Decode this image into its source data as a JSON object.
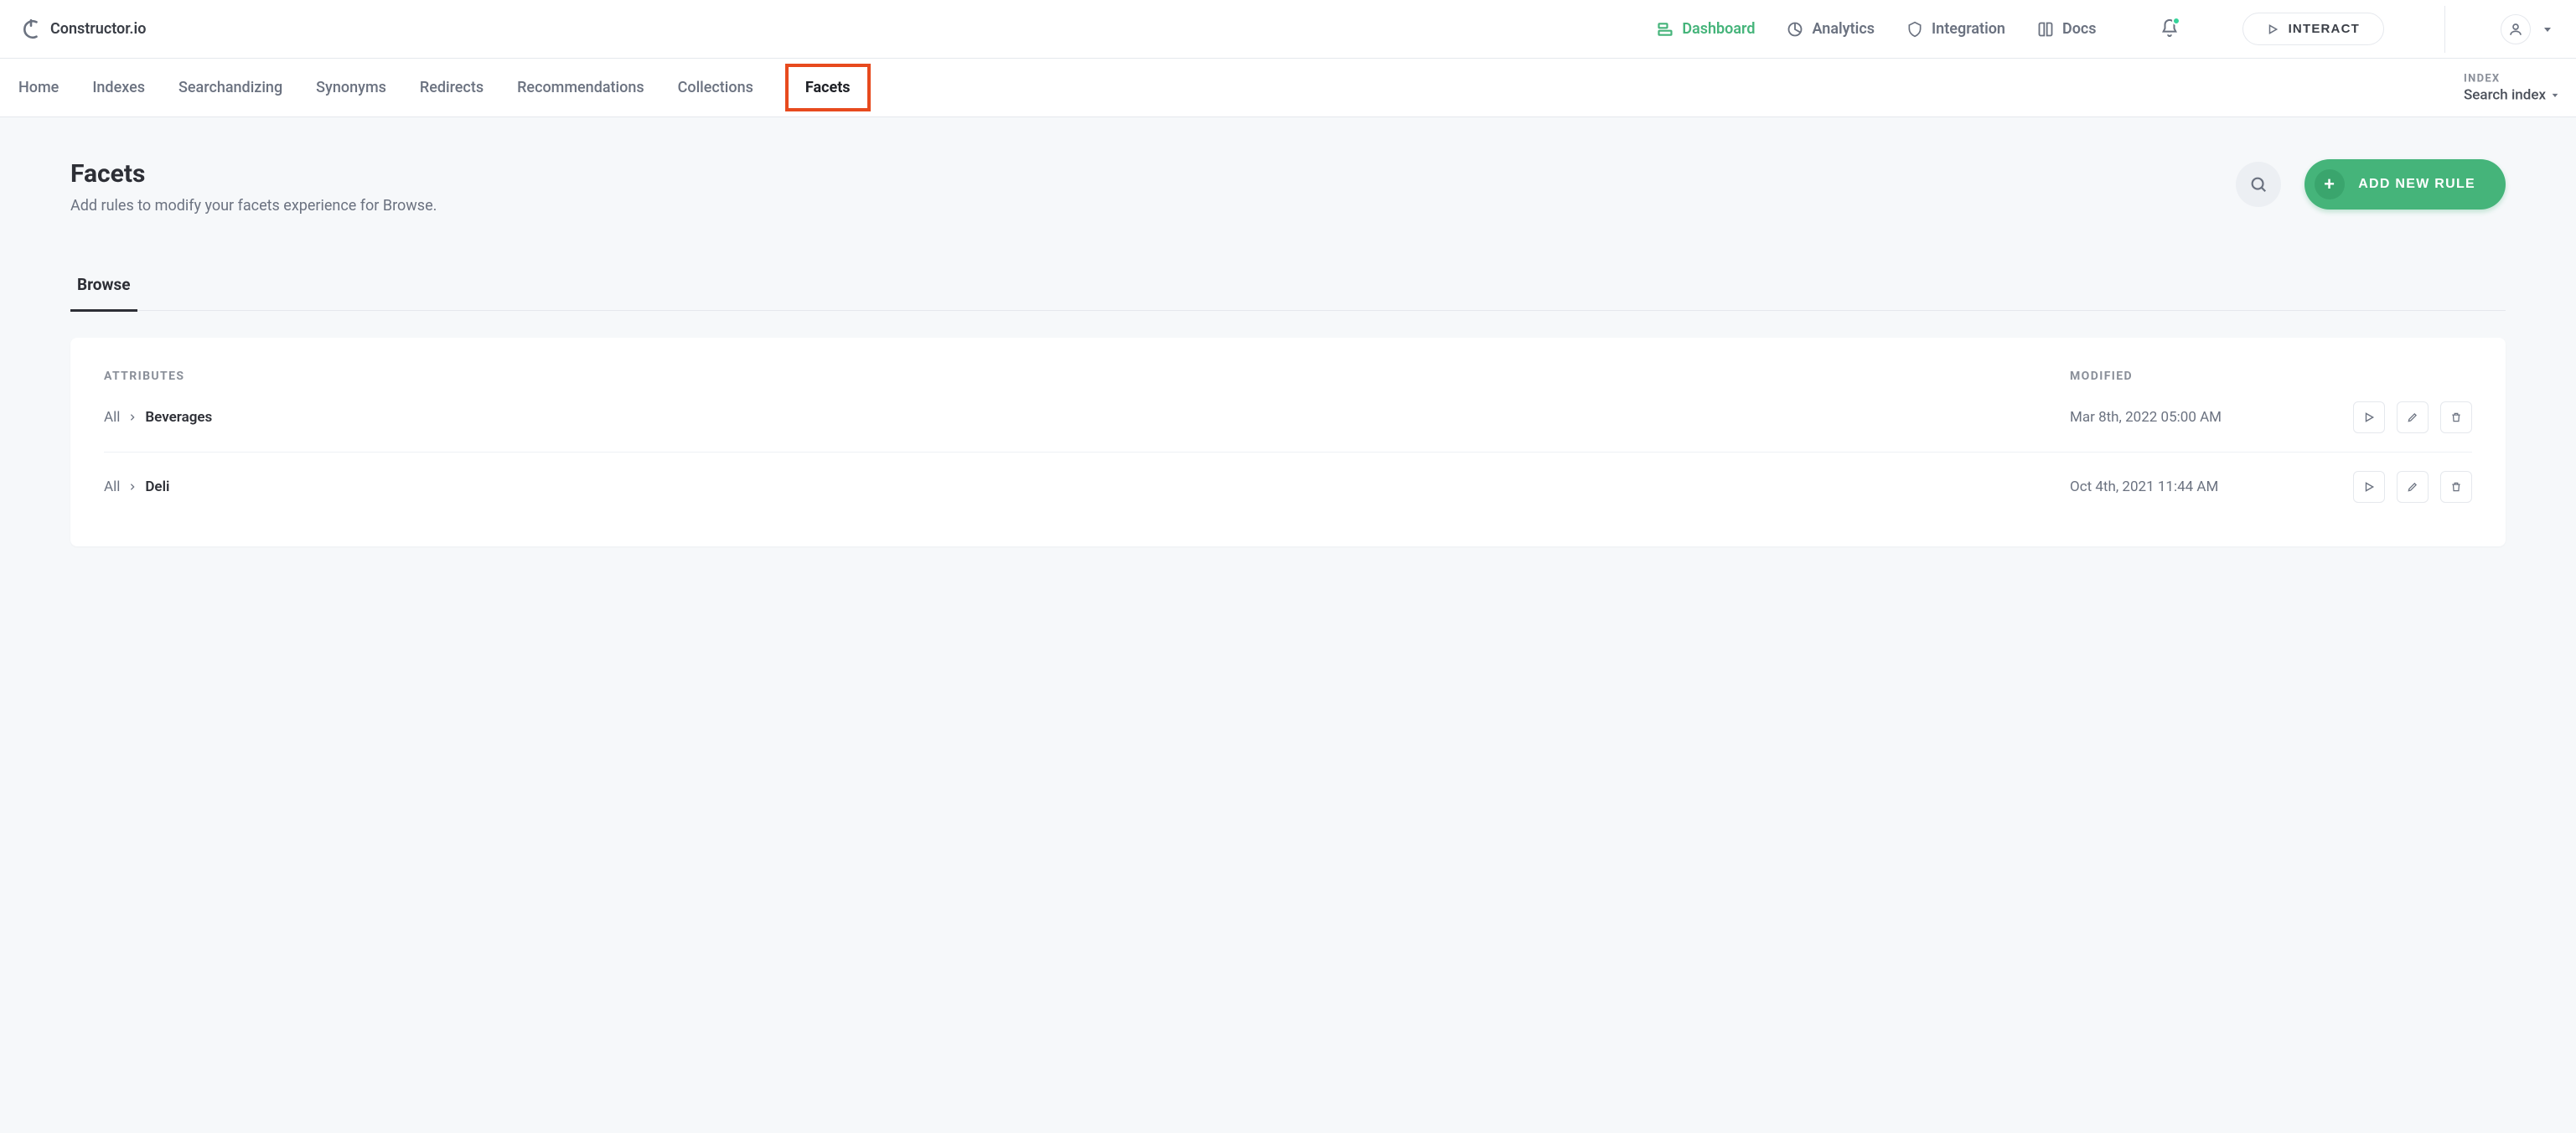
{
  "brand": {
    "name": "Constructor.io"
  },
  "topnav": {
    "dashboard": "Dashboard",
    "analytics": "Analytics",
    "integration": "Integration",
    "docs": "Docs",
    "interact": "INTERACT"
  },
  "subnav": {
    "items": [
      "Home",
      "Indexes",
      "Searchandizing",
      "Synonyms",
      "Redirects",
      "Recommendations",
      "Collections",
      "Facets"
    ],
    "active": "Facets"
  },
  "index_selector": {
    "label": "INDEX",
    "value": "Search index"
  },
  "page": {
    "title": "Facets",
    "subtitle": "Add rules to modify your facets experience for Browse.",
    "add_button": "ADD NEW RULE"
  },
  "tabs": {
    "browse": "Browse"
  },
  "table": {
    "columns": {
      "attributes": "Attributes",
      "modified": "Modified"
    },
    "rows": [
      {
        "root": "All",
        "leaf": "Beverages",
        "modified": "Mar 8th, 2022 05:00 AM"
      },
      {
        "root": "All",
        "leaf": "Deli",
        "modified": "Oct 4th, 2021 11:44 AM"
      }
    ]
  }
}
